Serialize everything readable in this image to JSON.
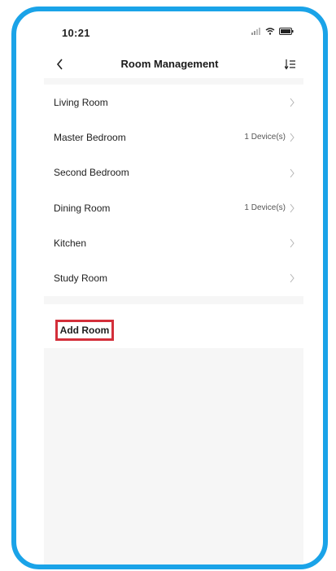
{
  "status_bar": {
    "time": "10:21"
  },
  "nav": {
    "title": "Room Management"
  },
  "rooms": [
    {
      "name": "Living Room",
      "meta": ""
    },
    {
      "name": "Master Bedroom",
      "meta": "1 Device(s)"
    },
    {
      "name": "Second Bedroom",
      "meta": ""
    },
    {
      "name": "Dining Room",
      "meta": "1 Device(s)"
    },
    {
      "name": "Kitchen",
      "meta": ""
    },
    {
      "name": "Study Room",
      "meta": ""
    }
  ],
  "add_room": {
    "label": "Add Room"
  },
  "colors": {
    "frame": "#1aa3e8",
    "highlight": "#d32f3a",
    "background": "#f6f6f6"
  },
  "icons": {
    "back": "chevron-left-icon",
    "sort": "sort-list-icon",
    "row": "chevron-right-icon",
    "status": [
      "signal-icon",
      "wifi-icon",
      "battery-icon"
    ]
  }
}
